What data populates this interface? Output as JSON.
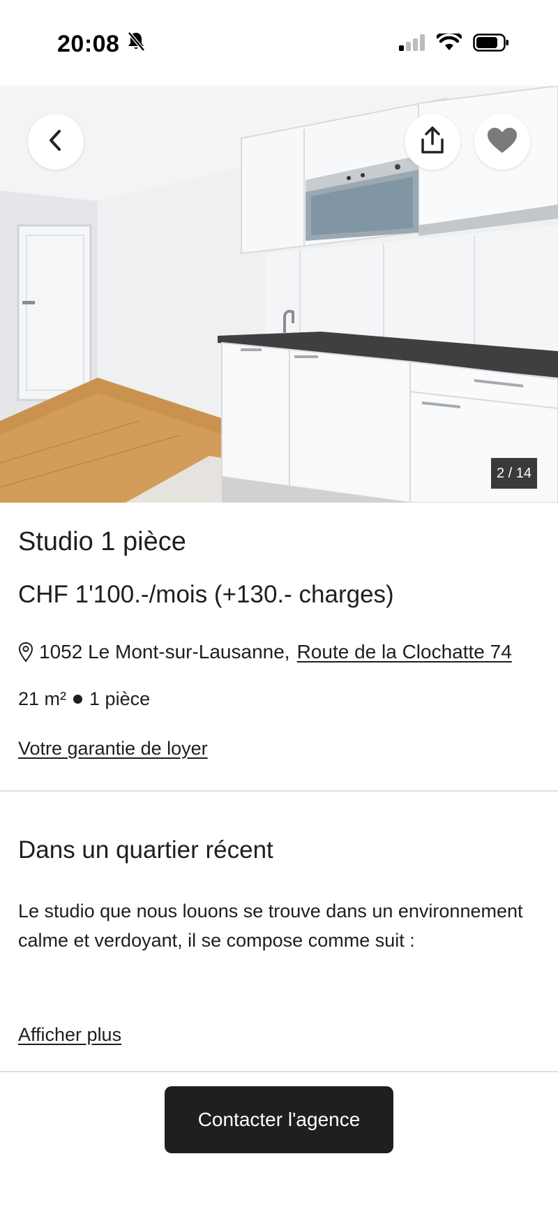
{
  "status_bar": {
    "time": "20:08",
    "icons": [
      "bell-slash-icon",
      "cellular-signal-icon",
      "wifi-icon",
      "battery-icon"
    ]
  },
  "gallery": {
    "counter": "2 / 14",
    "current": 2,
    "total": 14,
    "icons": [
      "chevron-left-icon",
      "share-icon",
      "heart-icon"
    ]
  },
  "listing": {
    "title": "Studio 1 pièce",
    "price": "CHF 1'100.-/mois (+130.- charges)",
    "address_city": "1052 Le Mont-sur-Lausanne,",
    "address_street": "Route de la Clochatte 74",
    "surface": "21 m²",
    "rooms": "1 pièce",
    "guarantee_link": "Votre garantie de loyer"
  },
  "description": {
    "heading": "Dans un quartier récent",
    "text": "Le studio que nous louons se trouve dans un environnement calme et verdoyant, il se compose comme suit :",
    "show_more": "Afficher plus"
  },
  "footer": {
    "contact_label": "Contacter l'agence"
  },
  "colors": {
    "text": "#1e1e1e",
    "button_bg": "#1f1f1f",
    "divider": "#dedede",
    "counter_bg": "#3a3a3a"
  }
}
